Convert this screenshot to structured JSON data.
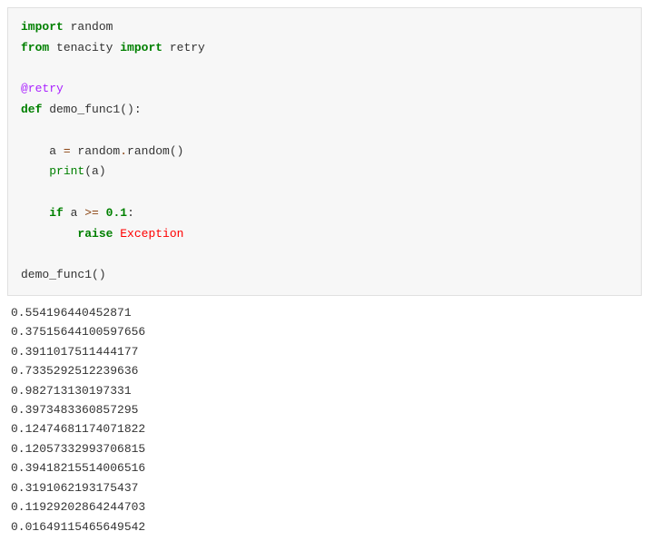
{
  "code": {
    "line1_kw": "import",
    "line1_mod": " random",
    "line2_kw1": "from",
    "line2_mod": " tenacity ",
    "line2_kw2": "import",
    "line2_name": " retry",
    "blank1": "",
    "line3_dec": "@retry",
    "line4_kw": "def",
    "line4_name": " demo_func1():",
    "blank2": "",
    "line5_indent": "    a ",
    "line5_op": "=",
    "line5_rest1": " random",
    "line5_op2": ".",
    "line5_rest2": "random()",
    "line6_indent": "    ",
    "line6_fn": "print",
    "line6_rest": "(a)",
    "blank3": "",
    "line7_indent": "    ",
    "line7_kw": "if",
    "line7_rest1": " a ",
    "line7_op": ">=",
    "line7_sp": " ",
    "line7_num": "0.1",
    "line7_colon": ":",
    "line8_indent": "        ",
    "line8_kw": "raise",
    "line8_sp": " ",
    "line8_exc": "Exception",
    "blank4": "",
    "line9": "demo_func1()"
  },
  "output": [
    "0.554196440452871",
    "0.37515644100597656",
    "0.3911017511444177",
    "0.7335292512239636",
    "0.982713130197331",
    "0.3973483360857295",
    "0.12474681174071822",
    "0.12057332993706815",
    "0.39418215514006516",
    "0.3191062193175437",
    "0.11929202864244703",
    "0.01649115465649542"
  ]
}
